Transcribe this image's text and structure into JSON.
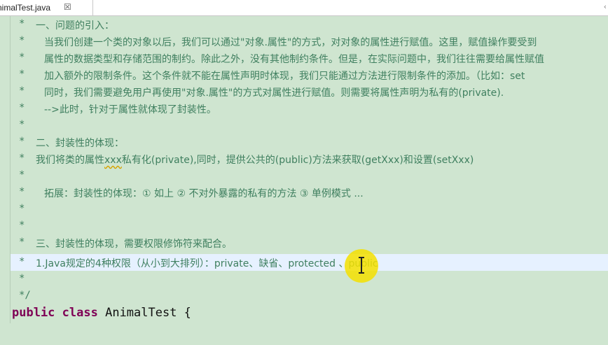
{
  "tab": {
    "title": "nimalTest.java",
    "close_glyph": "☒"
  },
  "lines": [
    {
      "star": "*",
      "text": "一、问题的引入："
    },
    {
      "star": "*",
      "text": "当我们创建一个类的对象以后，我们可以通过\"对象.属性\"的方式，对对象的属性进行赋值。这里，赋值操作要受到"
    },
    {
      "star": "*",
      "text": "属性的数据类型和存储范围的制约。除此之外，没有其他制约条件。但是，在实际问题中，我们往往需要给属性赋值"
    },
    {
      "star": "*",
      "text": "加入额外的限制条件。这个条件就不能在属性声明时体现，我们只能通过方法进行限制条件的添加。（比如：set"
    },
    {
      "star": "*",
      "text": "同时，我们需要避免用户再使用\"对象.属性\"的方式对属性进行赋值。则需要将属性声明为私有的(private)."
    },
    {
      "star": "*",
      "text": "-->此时，针对于属性就体现了封装性。"
    },
    {
      "star": "*",
      "text": ""
    },
    {
      "star": "*",
      "text": "二、封装性的体现："
    },
    {
      "star": "*",
      "text_a": "我们将类的属性",
      "text_sq": "xxx",
      "text_b": "私有化(private),同时，提供公共的(public)方法来获取(getXxx)和设置(setXxx)"
    },
    {
      "star": "*",
      "text": ""
    },
    {
      "star": "*",
      "text": "拓展：封装性的体现：① 如上 ② 不对外暴露的私有的方法 ③ 单例模式 ..."
    },
    {
      "star": "*",
      "text": ""
    },
    {
      "star": "*",
      "text": ""
    },
    {
      "star": "*",
      "text": "三、封装性的体现，需要权限修饰符来配合。"
    },
    {
      "star": "*",
      "text": "1.Java规定的4种权限（从小到大排列）：private、缺省、protected 、public"
    },
    {
      "star": "*",
      "text": ""
    },
    {
      "star": "*/",
      "text": ""
    }
  ],
  "code": {
    "kw1": "public",
    "kw2": "class",
    "rest": " AnimalTest {"
  }
}
